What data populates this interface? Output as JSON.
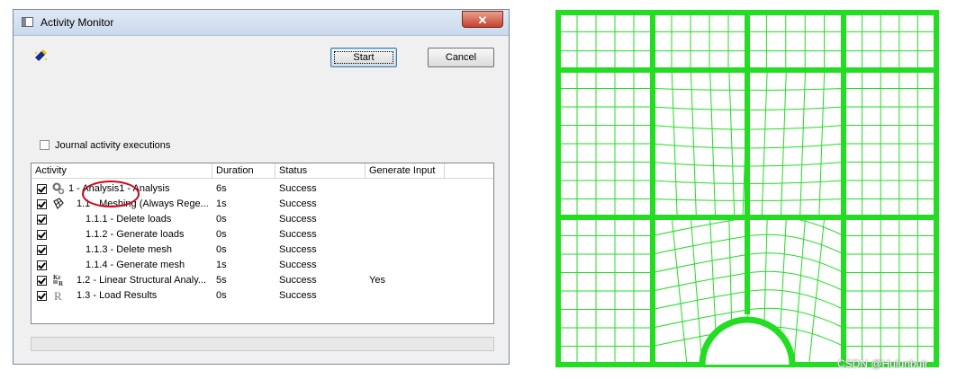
{
  "window": {
    "title": "Activity Monitor",
    "close_label": "✕"
  },
  "buttons": {
    "start": "Start",
    "cancel": "Cancel"
  },
  "journal": {
    "label": "Journal activity executions",
    "checked": false
  },
  "table": {
    "columns": [
      "Activity",
      "Duration",
      "Status",
      "Generate Input"
    ],
    "rows": [
      {
        "activity": "1 - Analysis1 - Analysis",
        "duration": "6s",
        "status": "Success",
        "generate_input": "",
        "icon": "gears-icon",
        "checked": true
      },
      {
        "activity": "1.1 - Meshing (Always Rege...",
        "duration": "1s",
        "status": "Success",
        "generate_input": "",
        "icon": "mesh-icon",
        "checked": true
      },
      {
        "activity": "1.1.1 - Delete loads",
        "duration": "0s",
        "status": "Success",
        "generate_input": "",
        "icon": "",
        "checked": true
      },
      {
        "activity": "1.1.2 - Generate loads",
        "duration": "0s",
        "status": "Success",
        "generate_input": "",
        "icon": "",
        "checked": true
      },
      {
        "activity": "1.1.3 - Delete mesh",
        "duration": "0s",
        "status": "Success",
        "generate_input": "",
        "icon": "",
        "checked": true
      },
      {
        "activity": "1.1.4 - Generate mesh",
        "duration": "1s",
        "status": "Success",
        "generate_input": "",
        "icon": "",
        "checked": true
      },
      {
        "activity": "1.2 - Linear Structural Analy...",
        "duration": "5s",
        "status": "Success",
        "generate_input": "Yes",
        "icon": "kr-icon",
        "checked": true
      },
      {
        "activity": "1.3 - Load Results",
        "duration": "0s",
        "status": "Success",
        "generate_input": "",
        "icon": "r-icon",
        "checked": true
      }
    ]
  },
  "colors": {
    "mesh_green": "#22dd22",
    "annotation_red": "#d0021b"
  },
  "watermark": "CSDN @Hulunbuir"
}
